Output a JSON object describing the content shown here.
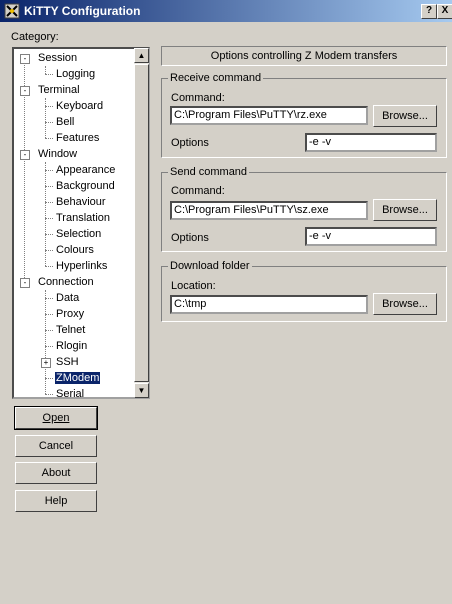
{
  "window": {
    "title": "KiTTY Configuration",
    "help_button": "?",
    "close_button": "X"
  },
  "category_label": "Category:",
  "tree": {
    "items": [
      {
        "label": "Session",
        "level": 0,
        "expander": "-"
      },
      {
        "label": "Logging",
        "level": 1
      },
      {
        "label": "Terminal",
        "level": 0,
        "expander": "-"
      },
      {
        "label": "Keyboard",
        "level": 1
      },
      {
        "label": "Bell",
        "level": 1
      },
      {
        "label": "Features",
        "level": 1
      },
      {
        "label": "Window",
        "level": 0,
        "expander": "-"
      },
      {
        "label": "Appearance",
        "level": 1
      },
      {
        "label": "Background",
        "level": 1
      },
      {
        "label": "Behaviour",
        "level": 1
      },
      {
        "label": "Translation",
        "level": 1
      },
      {
        "label": "Selection",
        "level": 1
      },
      {
        "label": "Colours",
        "level": 1
      },
      {
        "label": "Hyperlinks",
        "level": 1
      },
      {
        "label": "Connection",
        "level": 0,
        "expander": "-"
      },
      {
        "label": "Data",
        "level": 1
      },
      {
        "label": "Proxy",
        "level": 1
      },
      {
        "label": "Telnet",
        "level": 1
      },
      {
        "label": "Rlogin",
        "level": 1
      },
      {
        "label": "SSH",
        "level": 1,
        "expander": "+"
      },
      {
        "label": "ZModem",
        "level": 1,
        "selected": true
      },
      {
        "label": "Serial",
        "level": 1
      }
    ]
  },
  "buttons": {
    "open": "Open",
    "cancel": "Cancel",
    "about": "About",
    "help": "Help"
  },
  "panel": {
    "header": "Options controlling Z Modem transfers",
    "receive": {
      "group_title": "Receive command",
      "command_label": "Command:",
      "command_value": "C:\\Program Files\\PuTTY\\rz.exe",
      "browse_label": "Browse...",
      "options_label": "Options",
      "options_value": "-e -v"
    },
    "send": {
      "group_title": "Send command",
      "command_label": "Command:",
      "command_value": "C:\\Program Files\\PuTTY\\sz.exe",
      "browse_label": "Browse...",
      "options_label": "Options",
      "options_value": "-e -v"
    },
    "download": {
      "group_title": "Download folder",
      "location_label": "Location:",
      "location_value": "C:\\tmp",
      "browse_label": "Browse..."
    }
  },
  "colors": {
    "titlebar_start": "#0a246a",
    "titlebar_end": "#a6caf0",
    "face": "#d4d0c8",
    "selection": "#0a246a"
  }
}
